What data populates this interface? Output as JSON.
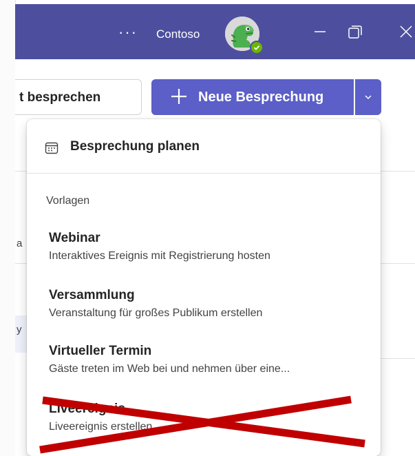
{
  "titlebar": {
    "more": "···",
    "org": "Contoso"
  },
  "toolbar": {
    "talk_label": "t besprechen",
    "new_meeting_label": "Neue Besprechung"
  },
  "menu": {
    "plan_label": "Besprechung planen",
    "section_label": "Vorlagen",
    "items": [
      {
        "title": "Webinar",
        "desc": "Interaktives Ereignis mit Registrierung hosten"
      },
      {
        "title": "Versammlung",
        "desc": "Veranstaltung für großes Publikum erstellen"
      },
      {
        "title": "Virtueller Termin",
        "desc": "Gäste treten im Web bei und nehmen über eine..."
      },
      {
        "title": "Liveereignis",
        "desc": "Liveereignis erstellen",
        "crossed_out": true
      }
    ]
  },
  "colors": {
    "titlebar": "#4d4f9e",
    "accent": "#5b5fc7",
    "cross": "#c00000",
    "status": "#6bb700"
  },
  "icons": [
    "more-icon",
    "avatar-dinosaur",
    "minimize-icon",
    "maximize-icon",
    "close-icon",
    "plus-icon",
    "chevron-down-icon",
    "calendar-icon"
  ]
}
